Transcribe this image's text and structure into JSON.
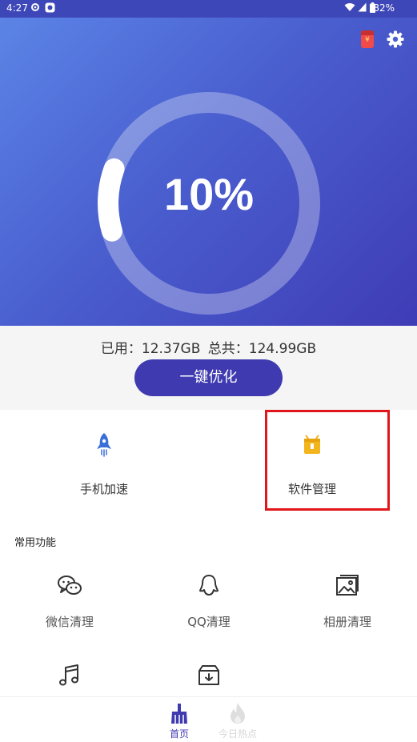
{
  "status_bar": {
    "time": "4:27",
    "battery": "82%"
  },
  "header": {
    "usage_percent": "10%",
    "usage_fraction": 0.1
  },
  "storage": {
    "used": "已用：12.37GB",
    "total": "总共：124.99GB"
  },
  "optimize_button": "一键优化",
  "quick_actions": [
    {
      "label": "手机加速",
      "icon": "rocket-icon"
    },
    {
      "label": "软件管理",
      "icon": "app-box-icon"
    }
  ],
  "section_title": "常用功能",
  "features": [
    {
      "label": "微信清理",
      "icon": "wechat-icon"
    },
    {
      "label": "QQ清理",
      "icon": "qq-icon"
    },
    {
      "label": "相册清理",
      "icon": "photo-album-icon"
    },
    {
      "label": "",
      "icon": "music-icon"
    },
    {
      "label": "",
      "icon": "download-box-icon"
    }
  ],
  "bottom_nav": [
    {
      "label": "首页",
      "icon": "broom-icon",
      "active": true
    },
    {
      "label": "今日热点",
      "icon": "flame-icon",
      "active": false
    }
  ],
  "colors": {
    "accent": "#3f3ab0",
    "highlight": "#e0161b",
    "icon_blue": "#3b6fd8",
    "icon_yellow": "#f2b51d"
  }
}
